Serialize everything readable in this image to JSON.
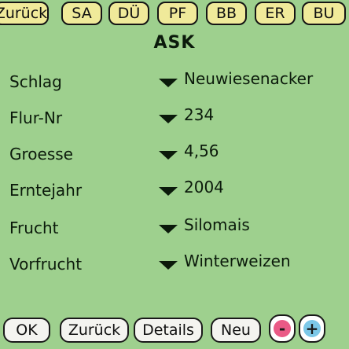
{
  "tabs": [
    "Zurück",
    "SA",
    "DÜ",
    "PF",
    "BB",
    "ER",
    "BU"
  ],
  "title": "ASK",
  "fields": [
    {
      "label": "Schlag",
      "value": "Neuwiesenacker"
    },
    {
      "label": "Flur-Nr",
      "value": "234"
    },
    {
      "label": "Groesse",
      "value": "4,56"
    },
    {
      "label": "Erntejahr",
      "value": "2004"
    },
    {
      "label": "Frucht",
      "value": "Silomais"
    },
    {
      "label": "Vorfrucht",
      "value": "Winterweizen"
    }
  ],
  "buttons": {
    "ok": "OK",
    "zurueck": "Zurück",
    "details": "Details",
    "neu": "Neu",
    "minus": "-",
    "plus": "+"
  },
  "icons": {
    "dropdown": "triangle-down-icon",
    "minus": "minus-icon",
    "plus": "plus-icon"
  },
  "colors": {
    "background": "#9ed08e",
    "tab_fill": "#f0ea9a",
    "button_fill": "#f4f4f0",
    "minus_accent": "#ea5a86",
    "plus_accent": "#7cc8e8"
  }
}
